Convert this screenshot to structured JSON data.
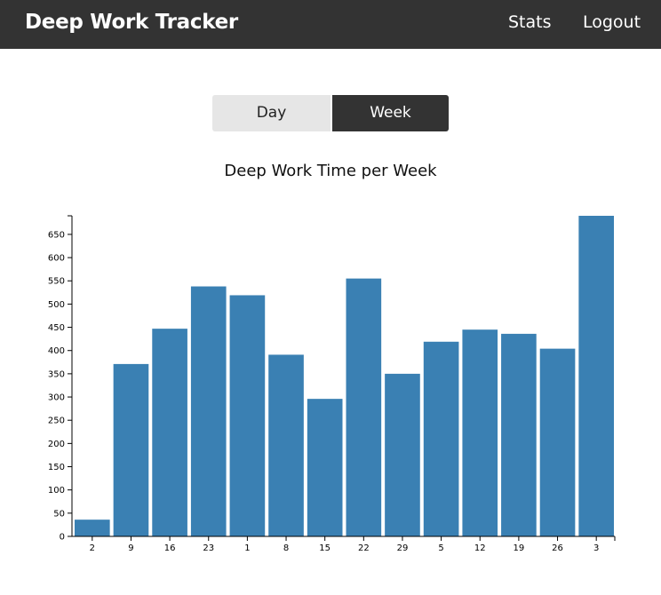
{
  "app": {
    "title": "Deep Work Tracker"
  },
  "nav": {
    "stats": "Stats",
    "logout": "Logout"
  },
  "toggle": {
    "day": "Day",
    "week": "Week",
    "selected": "Week"
  },
  "colors": {
    "bar": "#3a80b3",
    "navbar": "#333333"
  },
  "chart_data": {
    "type": "bar",
    "title": "Deep Work Time per Week",
    "xlabel": "",
    "ylabel": "",
    "categories": [
      "2",
      "9",
      "16",
      "23",
      "1",
      "8",
      "15",
      "22",
      "29",
      "5",
      "12",
      "19",
      "26",
      "3"
    ],
    "values": [
      36,
      371,
      447,
      538,
      519,
      391,
      296,
      555,
      350,
      419,
      445,
      436,
      404,
      690
    ],
    "ylim": [
      0,
      690
    ],
    "yticks": [
      0,
      50,
      100,
      150,
      200,
      250,
      300,
      350,
      400,
      450,
      500,
      550,
      600,
      650
    ],
    "grid": false
  }
}
